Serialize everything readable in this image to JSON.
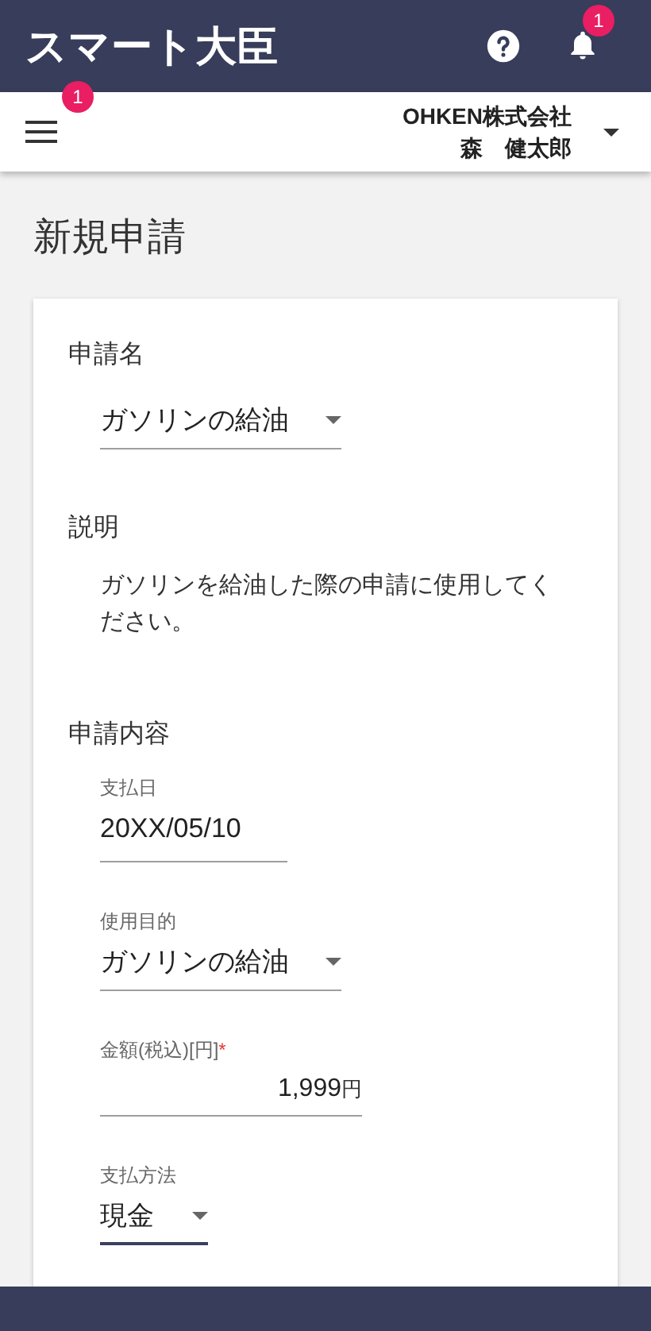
{
  "app_bar": {
    "title": "スマート大臣",
    "notification_badge": "1"
  },
  "sub_bar": {
    "menu_badge": "1",
    "company": "OHKEN株式会社",
    "user": "森　健太郎"
  },
  "page_title": "新規申請",
  "form": {
    "name_label": "申請名",
    "name_value": "ガソリンの給油",
    "description_label": "説明",
    "description": "ガソリンを給油した際の申請に使用してください。",
    "content_label": "申請内容",
    "fields": [
      {
        "kind": "date",
        "label": "支払日",
        "value": "20XX/05/10",
        "focused": false
      },
      {
        "kind": "select",
        "label": "使用目的",
        "value": "ガソリンの給油",
        "focused": false
      },
      {
        "kind": "amount",
        "label": "金額(税込)[円]",
        "required_mark": "*",
        "value": "1,999",
        "unit": "円",
        "focused": false
      },
      {
        "kind": "select",
        "label": "支払方法",
        "value": "現金",
        "focused": true
      }
    ]
  }
}
